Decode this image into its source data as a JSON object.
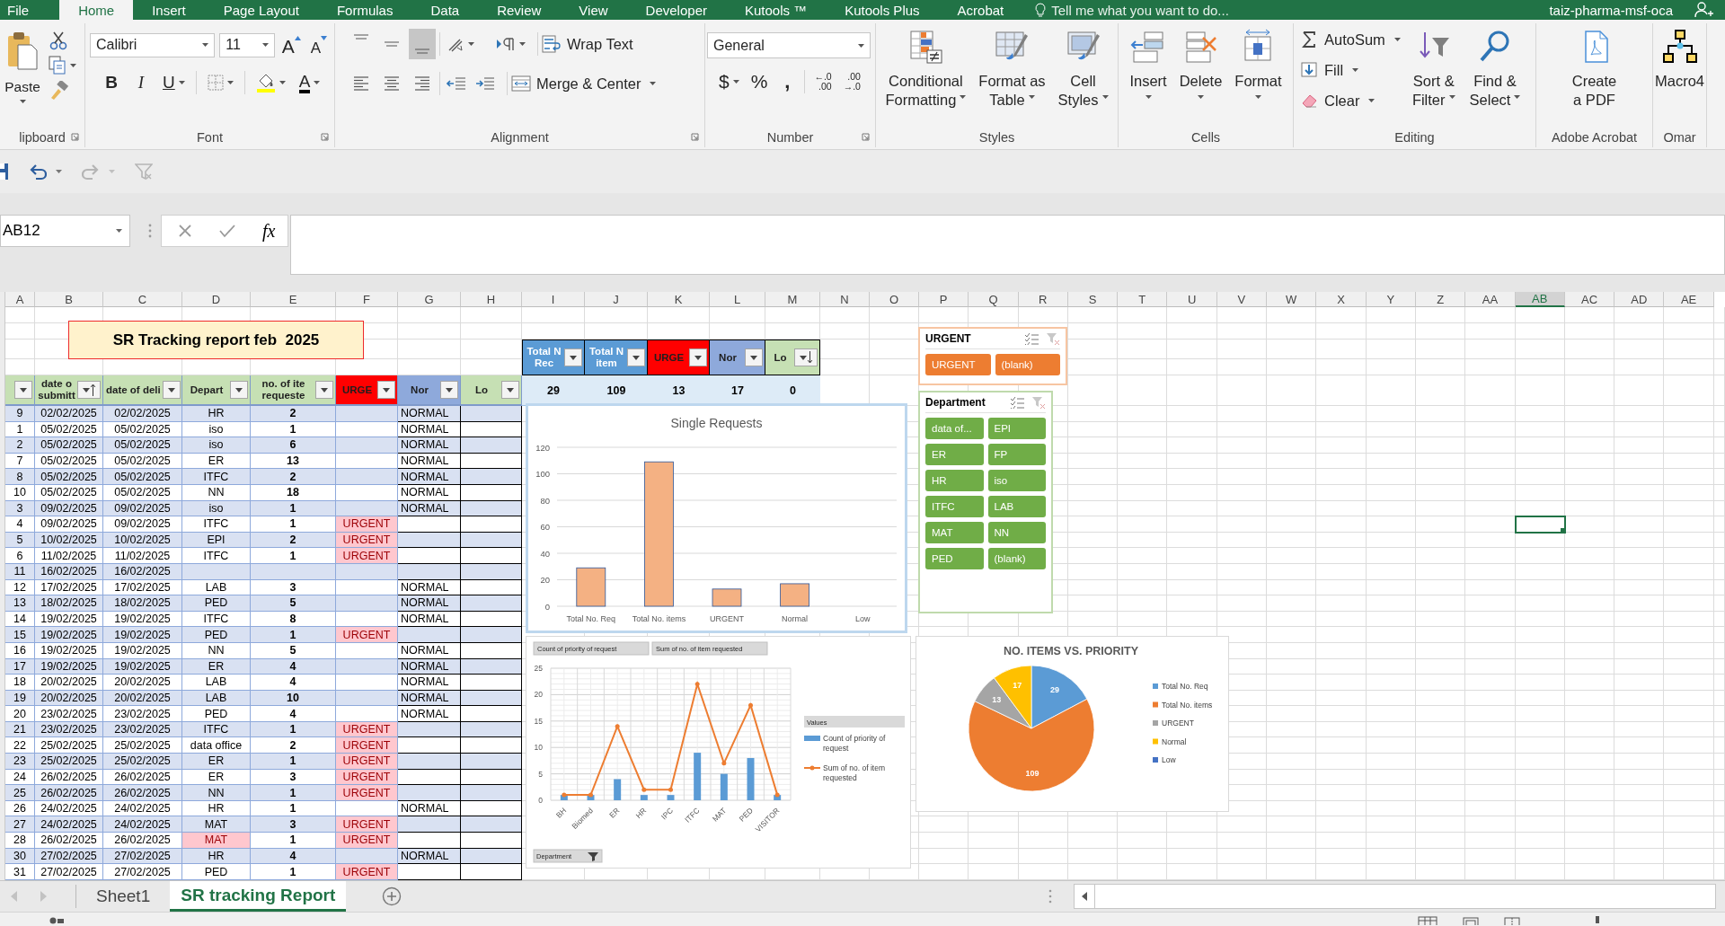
{
  "ribbon_tabs": [
    {
      "label": "File",
      "selected": false
    },
    {
      "label": "Home",
      "selected": true
    },
    {
      "label": "Insert",
      "selected": false
    },
    {
      "label": "Page Layout",
      "selected": false
    },
    {
      "label": "Formulas",
      "selected": false
    },
    {
      "label": "Data",
      "selected": false
    },
    {
      "label": "Review",
      "selected": false
    },
    {
      "label": "View",
      "selected": false
    },
    {
      "label": "Developer",
      "selected": false
    },
    {
      "label": "Kutools ™",
      "selected": false
    },
    {
      "label": "Kutools Plus",
      "selected": false
    },
    {
      "label": "Acrobat",
      "selected": false
    }
  ],
  "tell_me": "Tell me what you want to do...",
  "account": "taiz-pharma-msf-oca",
  "ribbon": {
    "groups": [
      {
        "kind": "clipboard",
        "label": "lipboard",
        "paste": "Paste"
      },
      {
        "kind": "font",
        "label": "Font",
        "font_name": "Calibri",
        "font_size": "11",
        "grow": "A",
        "shrink": "A",
        "bold": "B",
        "italic": "I",
        "underline": "U",
        "font_color": "A"
      },
      {
        "kind": "alignment",
        "label": "Alignment",
        "vertical": [
          {
            "selected": false
          },
          {
            "selected": false
          },
          {
            "selected": true
          }
        ],
        "wrap": "Wrap Text",
        "merge": "Merge & Center"
      },
      {
        "kind": "number",
        "label": "Number",
        "format": "General",
        "currency": "$",
        "percent": "%",
        "comma": ",",
        "decimals": [
          {
            "top": "←.0",
            "bottom": ".00"
          },
          {
            "top": ".00",
            "bottom": "→.0"
          }
        ]
      },
      {
        "kind": "large",
        "label": "Styles",
        "buttons": [
          {
            "kind": "conditional",
            "lines": [
              "Conditional",
              "Formatting"
            ],
            "dropdown": true
          },
          {
            "kind": "table",
            "lines": [
              "Format as",
              "Table"
            ],
            "dropdown": true
          },
          {
            "kind": "styles",
            "lines": [
              "Cell",
              "Styles"
            ],
            "dropdown": true
          }
        ]
      },
      {
        "kind": "large",
        "label": "Cells",
        "buttons": [
          {
            "kind": "insert",
            "lines": [
              "Insert"
            ],
            "dropdown": true
          },
          {
            "kind": "delete",
            "lines": [
              "Delete"
            ],
            "dropdown": true
          },
          {
            "kind": "format",
            "lines": [
              "Format"
            ],
            "dropdown": true
          }
        ]
      },
      {
        "kind": "editing",
        "label": "Editing",
        "small": [
          {
            "kind": "sum",
            "label": "AutoSum"
          },
          {
            "kind": "fill",
            "label": "Fill"
          },
          {
            "kind": "clear",
            "label": "Clear"
          }
        ],
        "buttons": [
          {
            "kind": "sort",
            "lines": [
              "Sort &",
              "Filter"
            ],
            "dropdown": true
          },
          {
            "kind": "find",
            "lines": [
              "Find &",
              "Select"
            ],
            "dropdown": true
          }
        ]
      },
      {
        "kind": "large",
        "label": "Adobe Acrobat",
        "buttons": [
          {
            "kind": "pdf",
            "lines": [
              "Create",
              "a PDF"
            ],
            "dropdown": false
          }
        ]
      },
      {
        "kind": "large",
        "label": "Omar",
        "buttons": [
          {
            "kind": "macro",
            "lines": [
              "Macro4"
            ],
            "dropdown": false
          }
        ]
      }
    ]
  },
  "quick_access": [
    {
      "kind": "save",
      "disabled": false
    },
    {
      "kind": "undo",
      "disabled": false
    },
    {
      "kind": "redo",
      "disabled": true
    },
    {
      "kind": "filter",
      "disabled": true
    }
  ],
  "name_box": "AB12",
  "function_button": "fx",
  "columns": [
    {
      "label": "A",
      "selected": false
    },
    {
      "label": "B",
      "selected": false
    },
    {
      "label": "C",
      "selected": false
    },
    {
      "label": "D",
      "selected": false
    },
    {
      "label": "E",
      "selected": false
    },
    {
      "label": "F",
      "selected": false
    },
    {
      "label": "G",
      "selected": false
    },
    {
      "label": "H",
      "selected": false
    },
    {
      "label": "I",
      "selected": false
    },
    {
      "label": "J",
      "selected": false
    },
    {
      "label": "K",
      "selected": false
    },
    {
      "label": "L",
      "selected": false
    },
    {
      "label": "M",
      "selected": false
    },
    {
      "label": "N",
      "selected": false
    },
    {
      "label": "O",
      "selected": false
    },
    {
      "label": "P",
      "selected": false
    },
    {
      "label": "Q",
      "selected": false
    },
    {
      "label": "R",
      "selected": false
    },
    {
      "label": "S",
      "selected": false
    },
    {
      "label": "T",
      "selected": false
    },
    {
      "label": "U",
      "selected": false
    },
    {
      "label": "V",
      "selected": false
    },
    {
      "label": "W",
      "selected": false
    },
    {
      "label": "X",
      "selected": false
    },
    {
      "label": "Y",
      "selected": false
    },
    {
      "label": "Z",
      "selected": false
    },
    {
      "label": "AA",
      "selected": false
    },
    {
      "label": "AB",
      "selected": true
    },
    {
      "label": "AC",
      "selected": false
    },
    {
      "label": "AD",
      "selected": false
    },
    {
      "label": "AE",
      "selected": false
    }
  ],
  "report_title": "SR Tracking report feb  2025",
  "summary_table": {
    "headers": [
      {
        "lines": [
          "Total N",
          "Rec"
        ],
        "color": "#5b9bd5",
        "sort_ascending": false,
        "sort_descending": false
      },
      {
        "lines": [
          "Total N",
          "item"
        ],
        "color": "#5b9bd5",
        "sort_ascending": false,
        "sort_descending": false
      },
      {
        "lines": [
          "URGE"
        ],
        "color": "#ff0000",
        "sort_ascending": false,
        "sort_descending": false
      },
      {
        "lines": [
          "Nor"
        ],
        "color": "#8ea9db",
        "sort_ascending": false,
        "sort_descending": false
      },
      {
        "lines": [
          "Lo"
        ],
        "color": "#c6e0b4",
        "sort_ascending": false,
        "sort_descending": true
      }
    ],
    "values": [
      "29",
      "109",
      "13",
      "17",
      "0"
    ]
  },
  "table": {
    "headers": [
      {
        "color": "#c6e0b4",
        "sort_ascending": false,
        "sort_descending": false
      },
      {
        "lines": [
          "date o",
          "submitt"
        ],
        "color": "#c6e0b4",
        "sort_ascending": true,
        "sort_descending": false
      },
      {
        "lines": [
          "date of deli"
        ],
        "color": "#c6e0b4",
        "sort_ascending": false,
        "sort_descending": false
      },
      {
        "lines": [
          "Depart"
        ],
        "color": "#c6e0b4",
        "sort_ascending": false,
        "sort_descending": false
      },
      {
        "lines": [
          "no. of ite",
          "requeste"
        ],
        "color": "#c6e0b4",
        "sort_ascending": false,
        "sort_descending": false
      },
      {
        "lines": [
          "URGE"
        ],
        "color": "#ff0000",
        "sort_ascending": false,
        "sort_descending": false
      },
      {
        "lines": [
          "Nor"
        ],
        "color": "#8ea9db",
        "sort_ascending": false,
        "sort_descending": false
      },
      {
        "lines": [
          "Lo"
        ],
        "color": "#c6e0b4",
        "sort_ascending": false,
        "sort_descending": false
      }
    ],
    "rows": [
      {
        "no": "9",
        "submitted": "02/02/2025",
        "delivered": "02/02/2025",
        "department": "HR",
        "items": "2",
        "normal": "NORMAL",
        "department_flagged": false
      },
      {
        "no": "1",
        "submitted": "05/02/2025",
        "delivered": "05/02/2025",
        "department": "iso",
        "items": "1",
        "normal": "NORMAL",
        "department_flagged": false
      },
      {
        "no": "2",
        "submitted": "05/02/2025",
        "delivered": "05/02/2025",
        "department": "iso",
        "items": "6",
        "normal": "NORMAL",
        "department_flagged": false
      },
      {
        "no": "7",
        "submitted": "05/02/2025",
        "delivered": "05/02/2025",
        "department": "ER",
        "items": "13",
        "normal": "NORMAL",
        "department_flagged": false
      },
      {
        "no": "8",
        "submitted": "05/02/2025",
        "delivered": "05/02/2025",
        "department": "ITFC",
        "items": "2",
        "normal": "NORMAL",
        "department_flagged": false
      },
      {
        "no": "10",
        "submitted": "05/02/2025",
        "delivered": "05/02/2025",
        "department": "NN",
        "items": "18",
        "normal": "NORMAL",
        "department_flagged": false
      },
      {
        "no": "3",
        "submitted": "09/02/2025",
        "delivered": "09/02/2025",
        "department": "iso",
        "items": "1",
        "normal": "NORMAL",
        "department_flagged": false
      },
      {
        "no": "4",
        "submitted": "09/02/2025",
        "delivered": "09/02/2025",
        "department": "ITFC",
        "items": "1",
        "urgent": "URGENT",
        "department_flagged": false
      },
      {
        "no": "5",
        "submitted": "10/02/2025",
        "delivered": "10/02/2025",
        "department": "EPI",
        "items": "2",
        "urgent": "URGENT",
        "department_flagged": false
      },
      {
        "no": "6",
        "submitted": "11/02/2025",
        "delivered": "11/02/2025",
        "department": "ITFC",
        "items": "1",
        "urgent": "URGENT",
        "department_flagged": false
      },
      {
        "no": "11",
        "submitted": "16/02/2025",
        "delivered": "16/02/2025",
        "department_flagged": false
      },
      {
        "no": "12",
        "submitted": "17/02/2025",
        "delivered": "17/02/2025",
        "department": "LAB",
        "items": "3",
        "normal": "NORMAL",
        "department_flagged": false
      },
      {
        "no": "13",
        "submitted": "18/02/2025",
        "delivered": "18/02/2025",
        "department": "PED",
        "items": "5",
        "normal": "NORMAL",
        "department_flagged": false
      },
      {
        "no": "14",
        "submitted": "19/02/2025",
        "delivered": "19/02/2025",
        "department": "ITFC",
        "items": "8",
        "normal": "NORMAL",
        "department_flagged": false
      },
      {
        "no": "15",
        "submitted": "19/02/2025",
        "delivered": "19/02/2025",
        "department": "PED",
        "items": "1",
        "urgent": "URGENT",
        "department_flagged": false
      },
      {
        "no": "16",
        "submitted": "19/02/2025",
        "delivered": "19/02/2025",
        "department": "NN",
        "items": "5",
        "normal": "NORMAL",
        "department_flagged": false
      },
      {
        "no": "17",
        "submitted": "19/02/2025",
        "delivered": "19/02/2025",
        "department": "ER",
        "items": "4",
        "normal": "NORMAL",
        "department_flagged": false
      },
      {
        "no": "18",
        "submitted": "20/02/2025",
        "delivered": "20/02/2025",
        "department": "LAB",
        "items": "4",
        "normal": "NORMAL",
        "department_flagged": false
      },
      {
        "no": "19",
        "submitted": "20/02/2025",
        "delivered": "20/02/2025",
        "department": "LAB",
        "items": "10",
        "normal": "NORMAL",
        "department_flagged": false
      },
      {
        "no": "20",
        "submitted": "23/02/2025",
        "delivered": "23/02/2025",
        "department": "PED",
        "items": "4",
        "normal": "NORMAL",
        "department_flagged": false
      },
      {
        "no": "21",
        "submitted": "23/02/2025",
        "delivered": "23/02/2025",
        "department": "ITFC",
        "items": "1",
        "urgent": "URGENT",
        "department_flagged": false
      },
      {
        "no": "22",
        "submitted": "25/02/2025",
        "delivered": "25/02/2025",
        "department": "data office",
        "items": "2",
        "urgent": "URGENT",
        "department_flagged": false
      },
      {
        "no": "23",
        "submitted": "25/02/2025",
        "delivered": "25/02/2025",
        "department": "ER",
        "items": "1",
        "urgent": "URGENT",
        "department_flagged": false
      },
      {
        "no": "24",
        "submitted": "26/02/2025",
        "delivered": "26/02/2025",
        "department": "ER",
        "items": "3",
        "urgent": "URGENT",
        "department_flagged": false
      },
      {
        "no": "25",
        "submitted": "26/02/2025",
        "delivered": "26/02/2025",
        "department": "NN",
        "items": "1",
        "urgent": "URGENT",
        "department_flagged": false
      },
      {
        "no": "26",
        "submitted": "24/02/2025",
        "delivered": "24/02/2025",
        "department": "HR",
        "items": "1",
        "normal": "NORMAL",
        "department_flagged": false
      },
      {
        "no": "27",
        "submitted": "24/02/2025",
        "delivered": "24/02/2025",
        "department": "MAT",
        "items": "3",
        "urgent": "URGENT",
        "department_flagged": false
      },
      {
        "no": "28",
        "submitted": "26/02/2025",
        "delivered": "26/02/2025",
        "department": "MAT",
        "items": "1",
        "urgent": "URGENT",
        "department_flagged": true
      },
      {
        "no": "30",
        "submitted": "27/02/2025",
        "delivered": "27/02/2025",
        "department": "HR",
        "items": "4",
        "normal": "NORMAL",
        "department_flagged": false
      },
      {
        "no": "31",
        "submitted": "27/02/2025",
        "delivered": "27/02/2025",
        "department": "PED",
        "items": "1",
        "urgent": "URGENT",
        "department_flagged": false
      }
    ]
  },
  "slicers": [
    {
      "title": "URGENT",
      "color": "#ed7d31",
      "items": [
        {
          "label": "URGENT",
          "selected": true
        },
        {
          "label": "(blank)",
          "selected": true
        }
      ]
    },
    {
      "title": "Department",
      "color": "#70ad47",
      "items": [
        {
          "label": "data of...",
          "selected": true
        },
        {
          "label": "EPI",
          "selected": true
        },
        {
          "label": "ER",
          "selected": true
        },
        {
          "label": "FP",
          "selected": true
        },
        {
          "label": "HR",
          "selected": true
        },
        {
          "label": "iso",
          "selected": true
        },
        {
          "label": "ITFC",
          "selected": true
        },
        {
          "label": "LAB",
          "selected": true
        },
        {
          "label": "MAT",
          "selected": true
        },
        {
          "label": "NN",
          "selected": true
        },
        {
          "label": "PED",
          "selected": true
        },
        {
          "label": "(blank)",
          "selected": true
        }
      ]
    }
  ],
  "charts": [
    {
      "chart_data": {
        "type": "bar",
        "title": "Single Requests",
        "categories": [
          "Total No. Req",
          "Total No. items",
          "URGENT",
          "Normal",
          "Low"
        ],
        "values": [
          29,
          109,
          13,
          17,
          0
        ],
        "ylim": [
          0,
          120
        ],
        "yticks": [
          0,
          20,
          40,
          60,
          80,
          100,
          120
        ],
        "grid": true
      }
    },
    {
      "field_buttons": [
        "Count of priority of request",
        "Sum of no. of item requested"
      ],
      "legend_title": "Values",
      "filter_button": "Department",
      "chart_data": {
        "type": "bar",
        "categories": [
          "BH",
          "Biomed",
          "ER",
          "HR",
          "IPC",
          "ITFC",
          "MAT",
          "PED",
          "VISITOR"
        ],
        "ylim": [
          0,
          25
        ],
        "yticks": [
          0,
          5,
          10,
          15,
          20,
          25
        ],
        "grid": true,
        "legend": "right",
        "series": [
          {
            "name": "Count of priority of request",
            "color": "#5b9bd5",
            "type": "bar",
            "values": [
              1,
              1,
              4,
              1,
              1,
              9,
              5,
              8,
              1
            ]
          },
          {
            "name": "Sum of no. of item requested",
            "color": "#ed7d31",
            "type": "line",
            "values": [
              1,
              1,
              14,
              2,
              2,
              22,
              7,
              18,
              1
            ]
          }
        ]
      }
    },
    {
      "chart_data": {
        "type": "pie",
        "title": "NO. ITEMS VS. PRIORITY",
        "categories": [
          "Total No. Req",
          "Total No. items",
          "URGENT",
          "Normal",
          "Low"
        ],
        "values": [
          29,
          109,
          13,
          17,
          0
        ],
        "colors": [
          "#5b9bd5",
          "#ed7d31",
          "#a5a5a5",
          "#ffc000",
          "#4472c4"
        ],
        "data_labels": true,
        "legend": "right"
      }
    }
  ],
  "sheet_tabs": [
    {
      "label": "Sheet1",
      "selected": false
    },
    {
      "label": "SR tracking Report",
      "selected": true
    }
  ]
}
